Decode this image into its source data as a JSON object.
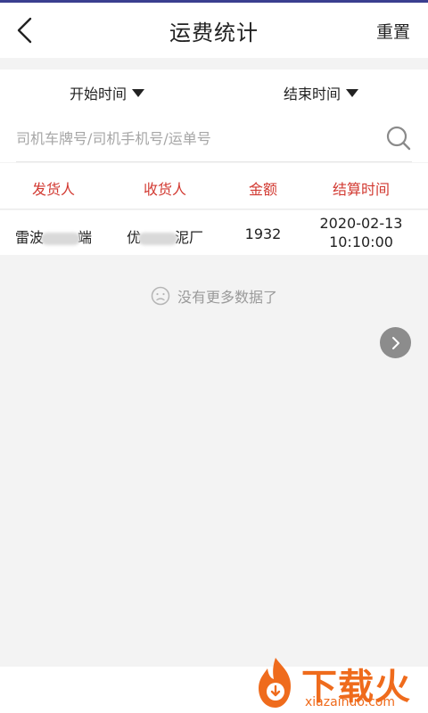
{
  "header": {
    "title": "运费统计",
    "reset_label": "重置",
    "back_icon": "chevron-left-icon"
  },
  "filters": {
    "start_label": "开始时间",
    "end_label": "结束时间"
  },
  "search": {
    "placeholder": "司机车牌号/司机手机号/运单号",
    "value": ""
  },
  "table": {
    "columns": [
      "发货人",
      "收货人",
      "金额",
      "结算时间"
    ],
    "rows": [
      {
        "shipper_prefix": "雷波",
        "shipper_suffix": "端",
        "receiver_prefix": "优",
        "receiver_suffix": "泥厂",
        "amount": "1932",
        "settle_date": "2020-02-13",
        "settle_time": "10:10:00"
      }
    ]
  },
  "empty_hint": "没有更多数据了",
  "watermark": {
    "brand": "下载火",
    "domain": "xiazaihuo.com"
  },
  "colors": {
    "accent_red": "#d23a32",
    "top_bar": "#3a3f8f",
    "watermark_orange": "#ef6b1c"
  }
}
